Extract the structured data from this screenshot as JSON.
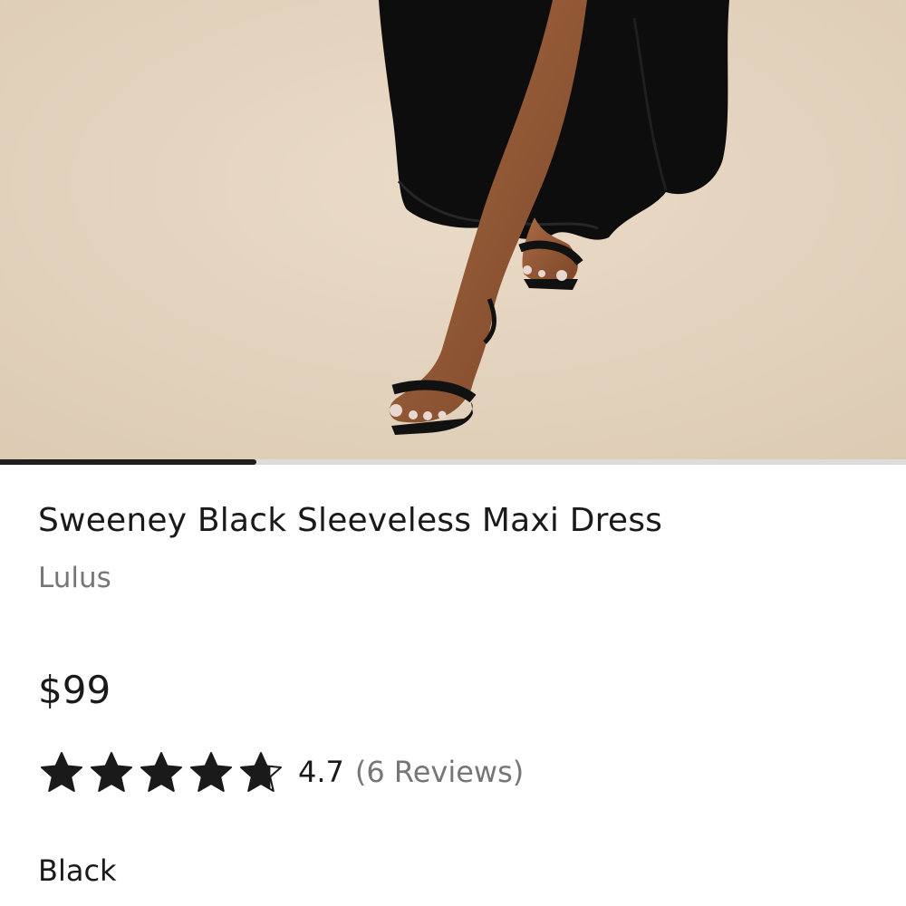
{
  "product": {
    "title": "Sweeney Black Sleeveless Maxi Dress",
    "brand": "Lulus",
    "price": "$99",
    "rating_value": "4.7",
    "rating_stars": 4.7,
    "review_count": "(6 Reviews)",
    "color": "Black"
  },
  "media": {
    "image_progress": 0.283,
    "progress_color": "#1e1e1e",
    "track_color": "#dcdcdc"
  },
  "icons": {
    "star": "star-icon",
    "partial_star": "star-half-icon"
  }
}
